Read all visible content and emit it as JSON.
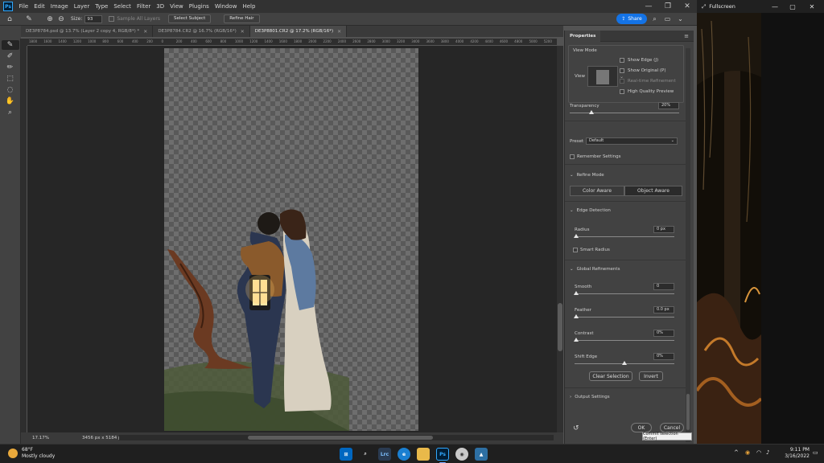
{
  "menubar": {
    "items": [
      "File",
      "Edit",
      "Image",
      "Layer",
      "Type",
      "Select",
      "Filter",
      "3D",
      "View",
      "Plugins",
      "Window",
      "Help"
    ]
  },
  "options": {
    "size_label": "Size:",
    "size_value": "93",
    "sample_all_layers": "Sample All Layers",
    "select_subject": "Select Subject",
    "refine_hair": "Refine Hair",
    "share_label": "Share"
  },
  "tabs": [
    {
      "label": "DE3P8784.psd @ 13.7% (Layer 2 copy 4, RGB/8*) *"
    },
    {
      "label": "DE3P8784.CR2 @ 16.7% (RGB/16*)"
    },
    {
      "label": "DE3P8801.CR2 @ 17.2% (RGB/16*)"
    }
  ],
  "ruler": {
    "ticks": [
      "1800",
      "1600",
      "1400",
      "1200",
      "1000",
      "800",
      "600",
      "400",
      "200",
      "0",
      "200",
      "400",
      "600",
      "800",
      "1000",
      "1200",
      "1400",
      "1600",
      "1800",
      "2000",
      "2200",
      "2400",
      "2600",
      "2800",
      "3000",
      "3200",
      "3400",
      "3600",
      "3800",
      "4000",
      "4200",
      "4400",
      "4600",
      "4800",
      "5000",
      "5200"
    ]
  },
  "status": {
    "zoom": "17.17%",
    "doc_info": "3456 px x 5184 px (300 ppi)"
  },
  "properties": {
    "tab": "Properties",
    "view_mode": {
      "title": "View Mode",
      "view_label": "View",
      "show_edge": "Show Edge (J)",
      "show_original": "Show Original (P)",
      "realtime_refinement": "Real-time Refinement",
      "high_quality_preview": "High Quality Preview"
    },
    "transparency": {
      "label": "Transparency",
      "value": "20%",
      "level": 0.2
    },
    "preset": {
      "label": "Preset",
      "value": "Default"
    },
    "remember_settings": "Remember Settings",
    "refine_mode": {
      "title": "Refine Mode",
      "color_aware": "Color Aware",
      "object_aware": "Object Aware"
    },
    "edge_detection": {
      "title": "Edge Detection",
      "radius_label": "Radius",
      "radius_value": "0 px",
      "smart_radius": "Smart Radius"
    },
    "global_refinements": {
      "title": "Global Refinements",
      "smooth_label": "Smooth",
      "smooth_value": "0",
      "feather_label": "Feather",
      "feather_value": "0.0 px",
      "contrast_label": "Contrast",
      "contrast_value": "0%",
      "shift_edge_label": "Shift Edge",
      "shift_edge_value": "0%",
      "shift_edge_level": 0.5
    },
    "clear_selection": "Clear Selection",
    "invert": "Invert",
    "output_settings": "Output Settings",
    "ok": "OK",
    "cancel": "Cancel",
    "tooltip": "Commit selection (Enter)"
  },
  "fullscreen": {
    "title": "Fullscreen"
  },
  "taskbar": {
    "temperature": "68°F",
    "weather": "Mostly cloudy",
    "time": "9:11 PM",
    "date": "3/16/2022"
  },
  "colors": {
    "accent": "#1473e6",
    "panel": "#424242",
    "canvas_bg": "#262626"
  }
}
